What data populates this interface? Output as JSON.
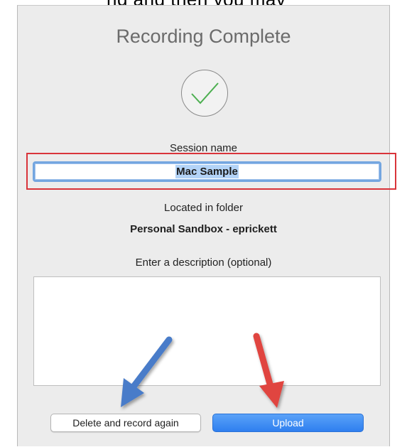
{
  "dialog": {
    "partial_header_text": "ng and then you may",
    "title": "Recording Complete",
    "icon": "checkmark-icon",
    "session": {
      "label": "Session name",
      "value": "Mac Sample"
    },
    "folder": {
      "label": "Located in folder",
      "name": "Personal Sandbox - eprickett"
    },
    "description": {
      "label": "Enter a description (optional)",
      "value": "",
      "placeholder": ""
    },
    "buttons": {
      "delete_label": "Delete and record again",
      "upload_label": "Upload"
    }
  },
  "annotations": {
    "highlight_color": "#d9343a",
    "arrow_blue": "#4a7cc9",
    "arrow_red": "#e0453f"
  },
  "colors": {
    "accent": "#2f7fef",
    "check_green": "#4caf50"
  }
}
